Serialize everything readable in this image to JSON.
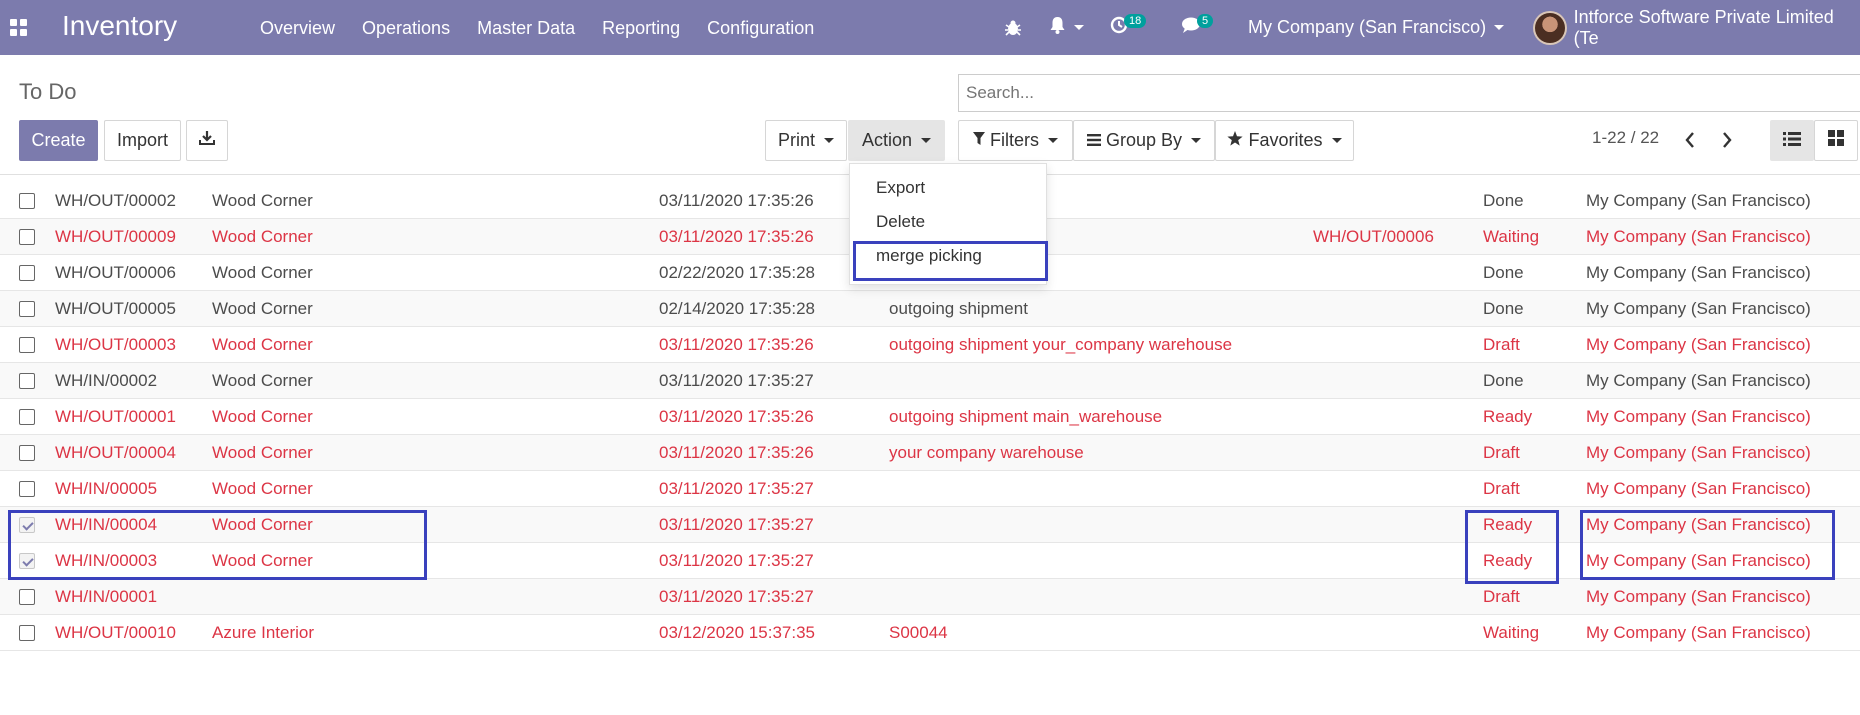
{
  "navbar": {
    "app_title": "Inventory",
    "menu": [
      "Overview",
      "Operations",
      "Master Data",
      "Reporting",
      "Configuration"
    ],
    "activity_count": "18",
    "message_count": "5",
    "company": "My Company (San Francisco)",
    "user": "Intforce Software Private Limited (Te"
  },
  "control": {
    "breadcrumb": "To Do",
    "search_placeholder": "Search...",
    "create": "Create",
    "import": "Import",
    "print": "Print",
    "action": "Action",
    "filters": "Filters",
    "group_by": "Group By",
    "favorites": "Favorites",
    "pager": "1-22 / 22"
  },
  "action_menu": [
    "Export",
    "Delete",
    "merge picking"
  ],
  "rows": [
    {
      "ref": "WH/OUT/00002",
      "partner": "Wood Corner",
      "date": "03/11/2020 17:35:26",
      "origin": "",
      "backorder": "",
      "status": "Done",
      "company": "My Company (San Francisco)",
      "checked": false
    },
    {
      "ref": "WH/OUT/00009",
      "partner": "Wood Corner",
      "date": "03/11/2020 17:35:26",
      "origin": "",
      "backorder": "WH/OUT/00006",
      "status": "Waiting",
      "company": "My Company (San Francisco)",
      "checked": false
    },
    {
      "ref": "WH/OUT/00006",
      "partner": "Wood Corner",
      "date": "02/22/2020 17:35:28",
      "origin": "",
      "backorder": "",
      "status": "Done",
      "company": "My Company (San Francisco)",
      "checked": false
    },
    {
      "ref": "WH/OUT/00005",
      "partner": "Wood Corner",
      "date": "02/14/2020 17:35:28",
      "origin": "outgoing shipment",
      "backorder": "",
      "status": "Done",
      "company": "My Company (San Francisco)",
      "checked": false
    },
    {
      "ref": "WH/OUT/00003",
      "partner": "Wood Corner",
      "date": "03/11/2020 17:35:26",
      "origin": "outgoing shipment your_company warehouse",
      "backorder": "",
      "status": "Draft",
      "company": "My Company (San Francisco)",
      "checked": false
    },
    {
      "ref": "WH/IN/00002",
      "partner": "Wood Corner",
      "date": "03/11/2020 17:35:27",
      "origin": "",
      "backorder": "",
      "status": "Done",
      "company": "My Company (San Francisco)",
      "checked": false
    },
    {
      "ref": "WH/OUT/00001",
      "partner": "Wood Corner",
      "date": "03/11/2020 17:35:26",
      "origin": "outgoing shipment main_warehouse",
      "backorder": "",
      "status": "Ready",
      "company": "My Company (San Francisco)",
      "checked": false
    },
    {
      "ref": "WH/OUT/00004",
      "partner": "Wood Corner",
      "date": "03/11/2020 17:35:26",
      "origin": "your company warehouse",
      "backorder": "",
      "status": "Draft",
      "company": "My Company (San Francisco)",
      "checked": false
    },
    {
      "ref": "WH/IN/00005",
      "partner": "Wood Corner",
      "date": "03/11/2020 17:35:27",
      "origin": "",
      "backorder": "",
      "status": "Draft",
      "company": "My Company (San Francisco)",
      "checked": false
    },
    {
      "ref": "WH/IN/00004",
      "partner": "Wood Corner",
      "date": "03/11/2020 17:35:27",
      "origin": "",
      "backorder": "",
      "status": "Ready",
      "company": "My Company (San Francisco)",
      "checked": true
    },
    {
      "ref": "WH/IN/00003",
      "partner": "Wood Corner",
      "date": "03/11/2020 17:35:27",
      "origin": "",
      "backorder": "",
      "status": "Ready",
      "company": "My Company (San Francisco)",
      "checked": true
    },
    {
      "ref": "WH/IN/00001",
      "partner": "",
      "date": "03/11/2020 17:35:27",
      "origin": "",
      "backorder": "",
      "status": "Draft",
      "company": "My Company (San Francisco)",
      "checked": false
    },
    {
      "ref": "WH/OUT/00010",
      "partner": "Azure Interior",
      "date": "03/12/2020 15:37:35",
      "origin": "S00044",
      "backorder": "",
      "status": "Waiting",
      "company": "My Company (San Francisco)",
      "checked": false
    }
  ],
  "colors": {
    "brand": "#7c7bad",
    "late_text": "#dc3545",
    "highlight_border": "#3a41bd"
  },
  "icons": [
    "apps-grid-icon",
    "bug-icon",
    "bell-icon",
    "activity-clock-icon",
    "chat-icon",
    "download-icon",
    "filter-icon",
    "list-bars-icon",
    "star-icon",
    "chevron-left-icon",
    "chevron-right-icon",
    "list-view-icon",
    "kanban-view-icon"
  ]
}
